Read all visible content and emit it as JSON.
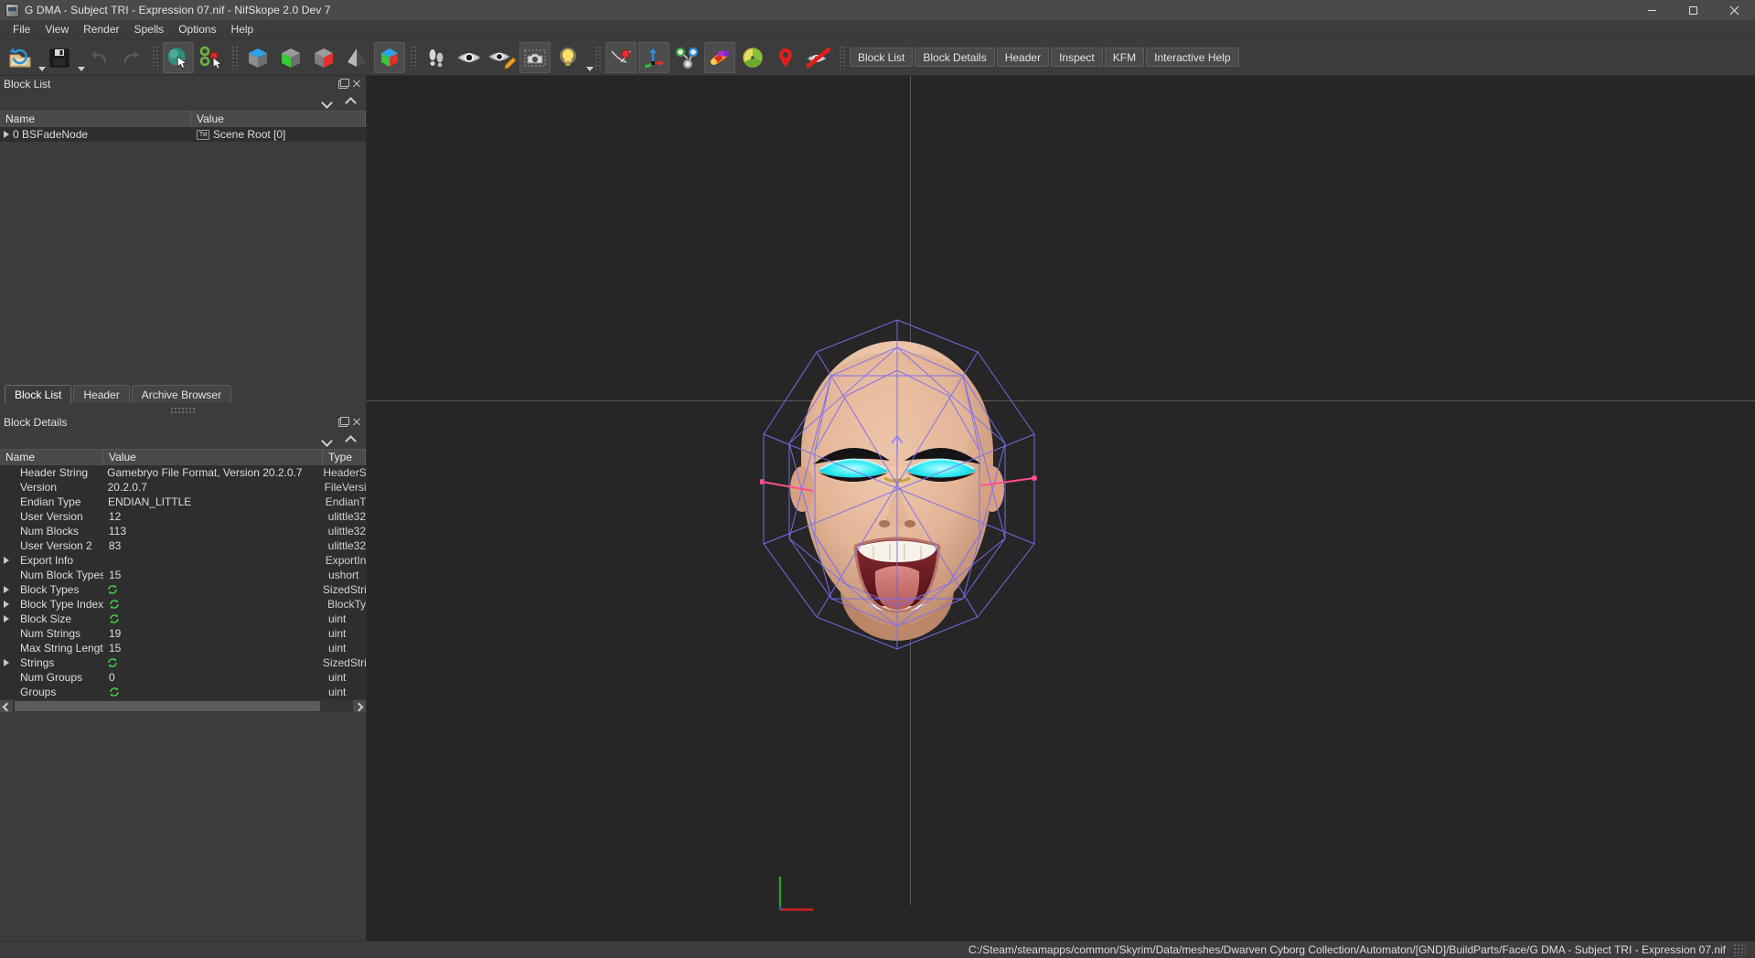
{
  "window": {
    "title": "G DMA - Subject TRI - Expression 07.nif - NifSkope 2.0 Dev 7",
    "minimize_label": "Minimize",
    "maximize_label": "Maximize",
    "close_label": "Close"
  },
  "menubar": {
    "items": [
      {
        "label": "File"
      },
      {
        "label": "View"
      },
      {
        "label": "Render"
      },
      {
        "label": "Spells"
      },
      {
        "label": "Options"
      },
      {
        "label": "Help"
      }
    ]
  },
  "toolbar": {
    "icons": [
      {
        "name": "open-file-icon",
        "title": "Open"
      },
      {
        "name": "save-file-icon",
        "title": "Save"
      },
      {
        "name": "undo-icon",
        "title": "Undo"
      },
      {
        "name": "redo-icon",
        "title": "Redo"
      },
      {
        "name": "render-sphere-icon",
        "title": "Select Object"
      },
      {
        "name": "select-nodes-icon",
        "title": "Select Vertex"
      },
      {
        "name": "view-top-icon",
        "title": "Top View"
      },
      {
        "name": "view-front-icon",
        "title": "Front View"
      },
      {
        "name": "view-side-icon",
        "title": "Side View"
      },
      {
        "name": "view-flip-icon",
        "title": "Flip View"
      },
      {
        "name": "view-perspective-icon",
        "title": "Perspective"
      },
      {
        "name": "walk-icon",
        "title": "Walk"
      },
      {
        "name": "show-hidden-icon",
        "title": "Show Hidden"
      },
      {
        "name": "draw-hidden-icon",
        "title": "Draw Hidden"
      },
      {
        "name": "screenshot-icon",
        "title": "Screenshot"
      },
      {
        "name": "lighting-icon",
        "title": "Lighting"
      },
      {
        "name": "draw-nodes-icon",
        "title": "Draw Nodes"
      },
      {
        "name": "draw-axes-icon",
        "title": "Draw Axes"
      },
      {
        "name": "draw-havok-icon",
        "title": "Draw Havok"
      },
      {
        "name": "draw-furniture-icon",
        "title": "Draw Furniture"
      },
      {
        "name": "draw-constraints-icon",
        "title": "Draw Constraints"
      },
      {
        "name": "draw-markers-icon",
        "title": "Draw Markers"
      },
      {
        "name": "draw-stencil-icon",
        "title": "Draw Stencil"
      }
    ],
    "text_buttons": [
      {
        "label": "Block List"
      },
      {
        "label": "Block Details"
      },
      {
        "label": "Header"
      },
      {
        "label": "Inspect"
      },
      {
        "label": "KFM"
      },
      {
        "label": "Interactive Help"
      }
    ]
  },
  "block_list": {
    "title": "Block List",
    "columns": [
      "Name",
      "Value"
    ],
    "rows": [
      {
        "name": "0 BSFadeNode",
        "value": "Scene Root [0]",
        "icon": "text-icon",
        "expandable": true
      }
    ]
  },
  "panel_tabs": [
    {
      "label": "Block List",
      "active": true
    },
    {
      "label": "Header",
      "active": false
    },
    {
      "label": "Archive Browser",
      "active": false
    }
  ],
  "block_details": {
    "title": "Block Details",
    "columns": [
      "Name",
      "Value",
      "Type"
    ],
    "rows": [
      {
        "name": "Header String",
        "value": "Gamebryo File Format, Version 20.2.0.7",
        "type": "HeaderS",
        "expandable": false,
        "refresh": false
      },
      {
        "name": "Version",
        "value": "20.2.0.7",
        "type": "FileVersi",
        "expandable": false,
        "refresh": false
      },
      {
        "name": "Endian Type",
        "value": "ENDIAN_LITTLE",
        "type": "EndianT",
        "expandable": false,
        "refresh": false
      },
      {
        "name": "User Version",
        "value": "12",
        "type": "ulittle32",
        "expandable": false,
        "refresh": false
      },
      {
        "name": "Num Blocks",
        "value": "113",
        "type": "ulittle32",
        "expandable": false,
        "refresh": false
      },
      {
        "name": "User Version 2",
        "value": "83",
        "type": "ulittle32",
        "expandable": false,
        "refresh": false
      },
      {
        "name": "Export Info",
        "value": "",
        "type": "ExportIn",
        "expandable": true,
        "refresh": false
      },
      {
        "name": "Num Block Types",
        "value": "15",
        "type": "ushort",
        "expandable": false,
        "refresh": false
      },
      {
        "name": "Block Types",
        "value": "",
        "type": "SizedStri",
        "expandable": true,
        "refresh": true
      },
      {
        "name": "Block Type Index",
        "value": "",
        "type": "BlockTy",
        "expandable": true,
        "refresh": true
      },
      {
        "name": "Block Size",
        "value": "",
        "type": "uint",
        "expandable": true,
        "refresh": true
      },
      {
        "name": "Num Strings",
        "value": "19",
        "type": "uint",
        "expandable": false,
        "refresh": false
      },
      {
        "name": "Max String Length",
        "value": "15",
        "type": "uint",
        "expandable": false,
        "refresh": false
      },
      {
        "name": "Strings",
        "value": "",
        "type": "SizedStri",
        "expandable": true,
        "refresh": true
      },
      {
        "name": "Num Groups",
        "value": "0",
        "type": "uint",
        "expandable": false,
        "refresh": false
      },
      {
        "name": "Groups",
        "value": "",
        "type": "uint",
        "expandable": false,
        "refresh": true
      }
    ]
  },
  "statusbar": {
    "path": "C:/Steam/steamapps/common/Skyrim/Data/meshes/Dwarven Cyborg Collection/Automaton/[GND]/BuildParts/Face/G DMA - Subject TRI - Expression 07.nif"
  },
  "viewport": {
    "name": "3d-viewport",
    "wireframe_color": "#7b6ef0",
    "axis_color": "#5a5a5a",
    "gizmo": {
      "x_color": "#d02020",
      "y_color": "#2aa02a",
      "z_color": "#2a60d0"
    }
  }
}
